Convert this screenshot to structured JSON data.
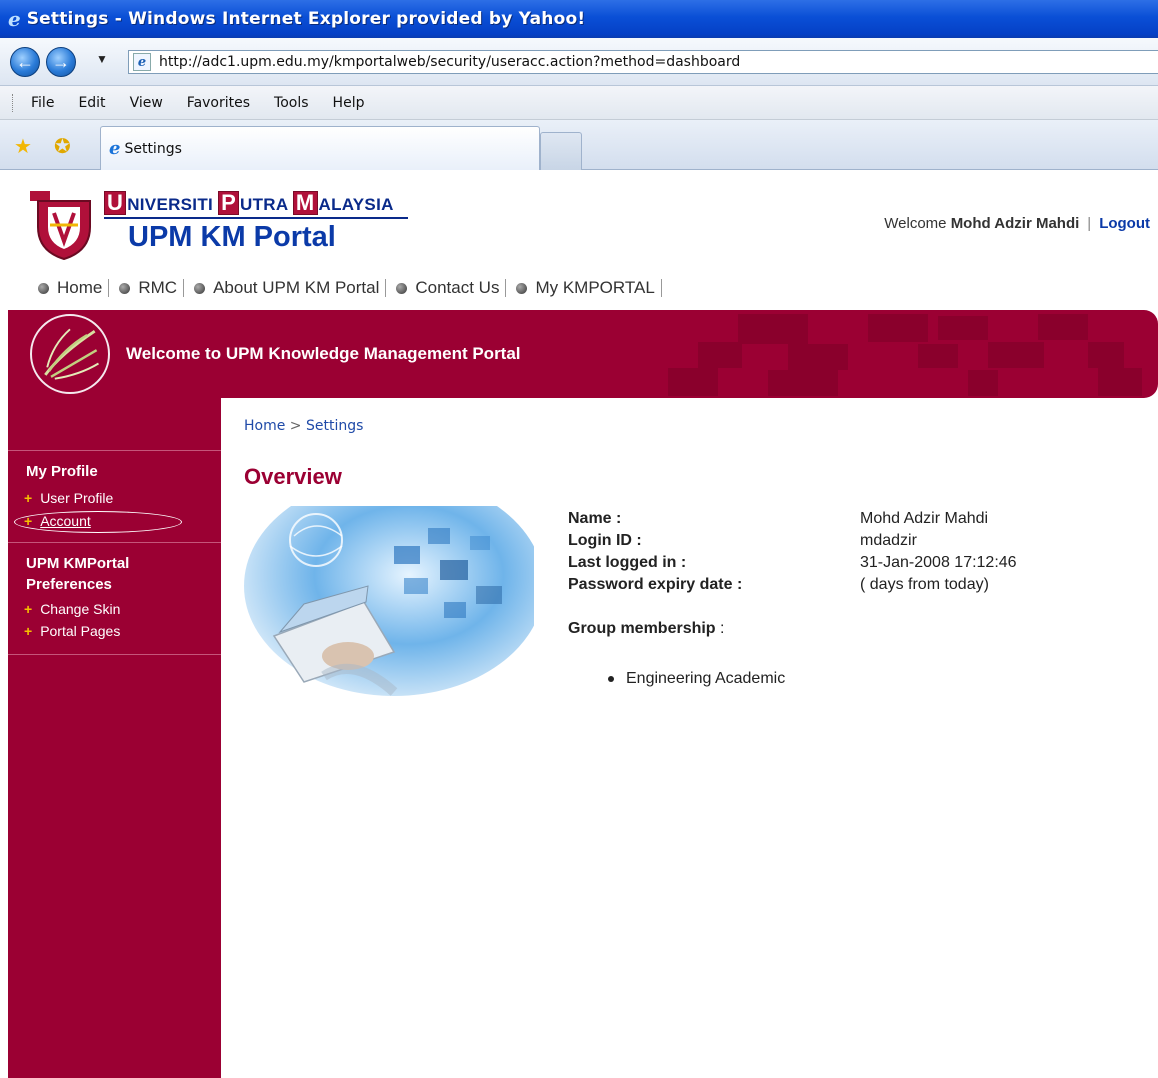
{
  "browser": {
    "window_title": "Settings - Windows Internet Explorer provided by Yahoo!",
    "url": "http://adc1.upm.edu.my/kmportalweb/security/useracc.action?method=dashboard",
    "menu": [
      "File",
      "Edit",
      "View",
      "Favorites",
      "Tools",
      "Help"
    ],
    "tab_label": "Settings",
    "icons": {
      "back": "back-arrow-icon",
      "forward": "forward-arrow-icon",
      "favorites": "star-icon",
      "add_favorite": "add-star-icon"
    }
  },
  "header": {
    "university": {
      "u_cap": "U",
      "u_rest": "NIVERSITI",
      "p_cap": "P",
      "p_rest": "UTRA",
      "m_cap": "M",
      "m_rest": "ALAYSIA"
    },
    "portal_name": "UPM KM Portal",
    "welcome_prefix": "Welcome",
    "user_name": "Mohd Adzir Mahdi",
    "separator": "|",
    "logout_label": "Logout",
    "nav": [
      "Home",
      "RMC",
      "About UPM KM Portal",
      "Contact Us",
      "My KMPORTAL"
    ]
  },
  "banner": {
    "text": "Welcome to UPM Knowledge Management Portal"
  },
  "sidebar": {
    "section1_title": "My Profile",
    "section1_items": [
      "User Profile",
      "Account"
    ],
    "section2_title_line1": "UPM KMPortal",
    "section2_title_line2": "Preferences",
    "section2_items": [
      "Change Skin",
      "Portal Pages"
    ],
    "bullet": "+"
  },
  "content": {
    "breadcrumb": {
      "home": "Home",
      "sep": ">",
      "current": "Settings"
    },
    "title": "Overview",
    "fields": [
      {
        "label": "Name :",
        "value": "Mohd Adzir Mahdi"
      },
      {
        "label": "Login ID :",
        "value": "mdadzir"
      },
      {
        "label": "Last logged in :",
        "value": "31-Jan-2008 17:12:46"
      },
      {
        "label": "Password expiry date :",
        "value": "( days from today)"
      }
    ],
    "group_label": "Group membership",
    "group_colon": " :",
    "groups": [
      "Engineering Academic"
    ]
  },
  "colors": {
    "brand_maroon": "#9b0033",
    "brand_blue": "#0b3aa8",
    "bullet_yellow": "#f5c000"
  }
}
